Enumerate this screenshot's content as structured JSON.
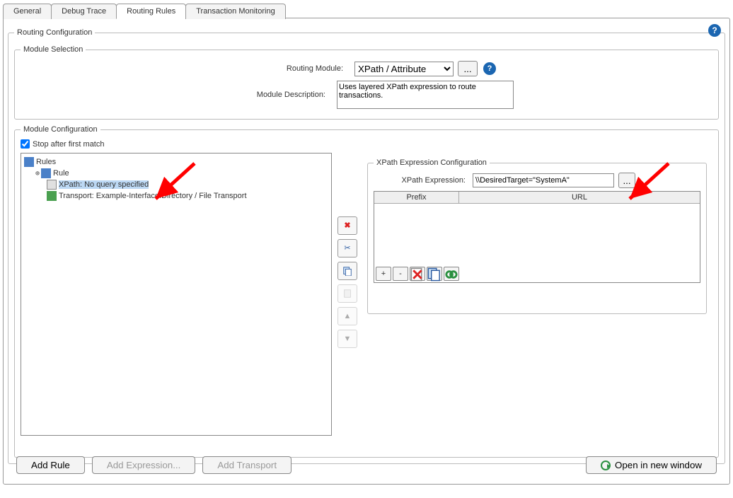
{
  "tabs": {
    "general": "General",
    "debug": "Debug Trace",
    "routing": "Routing Rules",
    "txmon": "Transaction Monitoring"
  },
  "routingConfig": {
    "legend": "Routing Configuration"
  },
  "moduleSelection": {
    "legend": "Module Selection",
    "routingModuleLabel": "Routing Module:",
    "routingModuleValue": "XPath / Attribute",
    "moreBtn": "...",
    "moduleDescLabel": "Module Description:",
    "moduleDescValue": "Uses layered XPath expression to route transactions."
  },
  "moduleConfig": {
    "legend": "Module Configuration",
    "stopAfterLabel": "Stop after first match",
    "tree": {
      "rules": "Rules",
      "rule": "Rule",
      "xpath": "XPath: No query specified",
      "transport": "Transport: Example-Interface.Directory / File Transport"
    }
  },
  "xpathPanel": {
    "legend": "XPath Expression Configuration",
    "exprLabel": "XPath Expression:",
    "exprValue": "\\\\DesiredTarget=\"SystemA\"",
    "prefixHeader": "Prefix",
    "urlHeader": "URL",
    "nsAdd": "+",
    "nsRemove": "-"
  },
  "bottom": {
    "addRule": "Add Rule",
    "addExpression": "Add Expression...",
    "addTransport": "Add Transport",
    "openNew": "Open in new window"
  }
}
